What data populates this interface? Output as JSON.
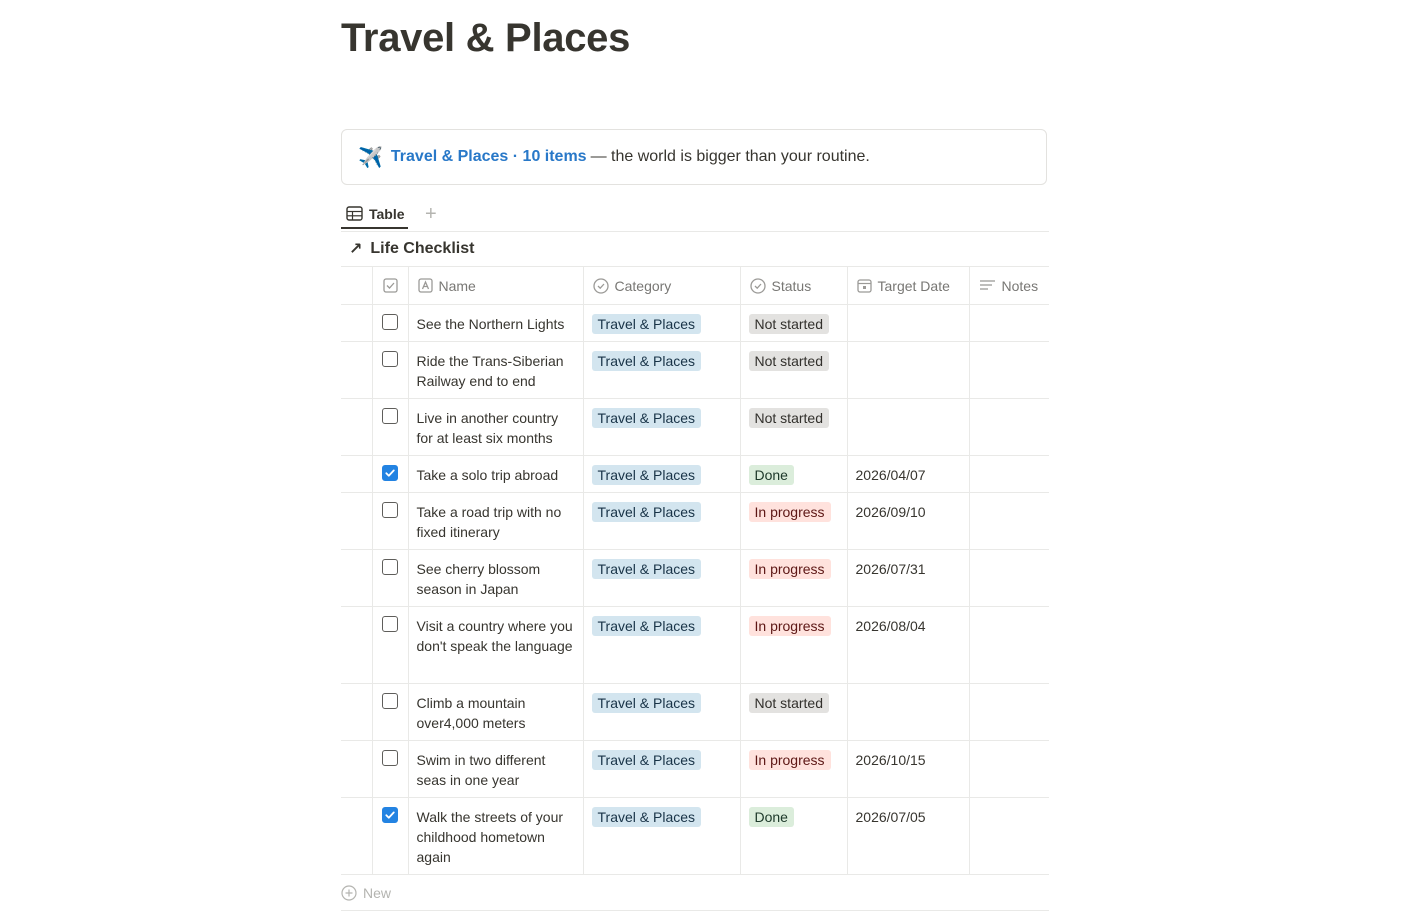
{
  "page": {
    "title": "Travel & Places"
  },
  "callout": {
    "emoji": "✈️",
    "link_text": "Travel & Places · 10 items",
    "rest_text": "— the world is bigger than your routine."
  },
  "views": {
    "active_tab": "Table",
    "add_view_glyph": "+"
  },
  "database": {
    "title": "Life Checklist",
    "arrow_glyph": "↗"
  },
  "columns": {
    "checkbox": "",
    "name": "Name",
    "category": "Category",
    "status": "Status",
    "target_date": "Target Date",
    "notes": "Notes"
  },
  "rows": [
    {
      "done": false,
      "name": "See the Northern Lights",
      "category": "Travel & Places",
      "status": "Not started",
      "status_kind": "not",
      "date": ""
    },
    {
      "done": false,
      "name": "Ride the Trans-Siberian Railway end to end",
      "category": "Travel & Places",
      "status": "Not started",
      "status_kind": "not",
      "date": ""
    },
    {
      "done": false,
      "name": "Live in another country for at least six months",
      "category": "Travel & Places",
      "status": "Not started",
      "status_kind": "not",
      "date": ""
    },
    {
      "done": true,
      "name": "Take a solo trip abroad",
      "category": "Travel & Places",
      "status": "Done",
      "status_kind": "done",
      "date": "2026/04/07"
    },
    {
      "done": false,
      "name": "Take a road trip with no fixed itinerary",
      "category": "Travel & Places",
      "status": "In progress",
      "status_kind": "prog",
      "date": "2026/09/10"
    },
    {
      "done": false,
      "name": "See cherry blossom season in Japan",
      "category": "Travel & Places",
      "status": "In progress",
      "status_kind": "prog",
      "date": "2026/07/31"
    },
    {
      "done": false,
      "name": "Visit a country where you don't speak the language",
      "category": "Travel & Places",
      "status": "In progress",
      "status_kind": "prog",
      "date": "2026/08/04"
    },
    {
      "done": false,
      "name": "Climb a mountain over4,000 meters",
      "category": "Travel & Places",
      "status": "Not started",
      "status_kind": "not",
      "date": ""
    },
    {
      "done": false,
      "name": "Swim in two different seas in one year",
      "category": "Travel & Places",
      "status": "In progress",
      "status_kind": "prog",
      "date": "2026/10/15"
    },
    {
      "done": true,
      "name": "Walk the streets of your childhood hometown again",
      "category": "Travel & Places",
      "status": "Done",
      "status_kind": "done",
      "date": "2026/07/05"
    }
  ],
  "new_row": {
    "label": "New"
  },
  "colors": {
    "accent_link": "#2878c8",
    "checkbox_checked": "#2383e2",
    "pill_category": "#d3e5ef",
    "pill_not_started": "#e3e2e0",
    "pill_done": "#dbeddb",
    "pill_in_progress": "#ffe2dd"
  },
  "icons": {
    "table_view": "table-icon",
    "name_column": "text-property-icon",
    "category_column": "select-property-icon",
    "status_column": "status-property-icon",
    "date_column": "calendar-icon",
    "notes_column": "text-lines-icon",
    "checkbox_column": "checkbox-property-icon"
  }
}
